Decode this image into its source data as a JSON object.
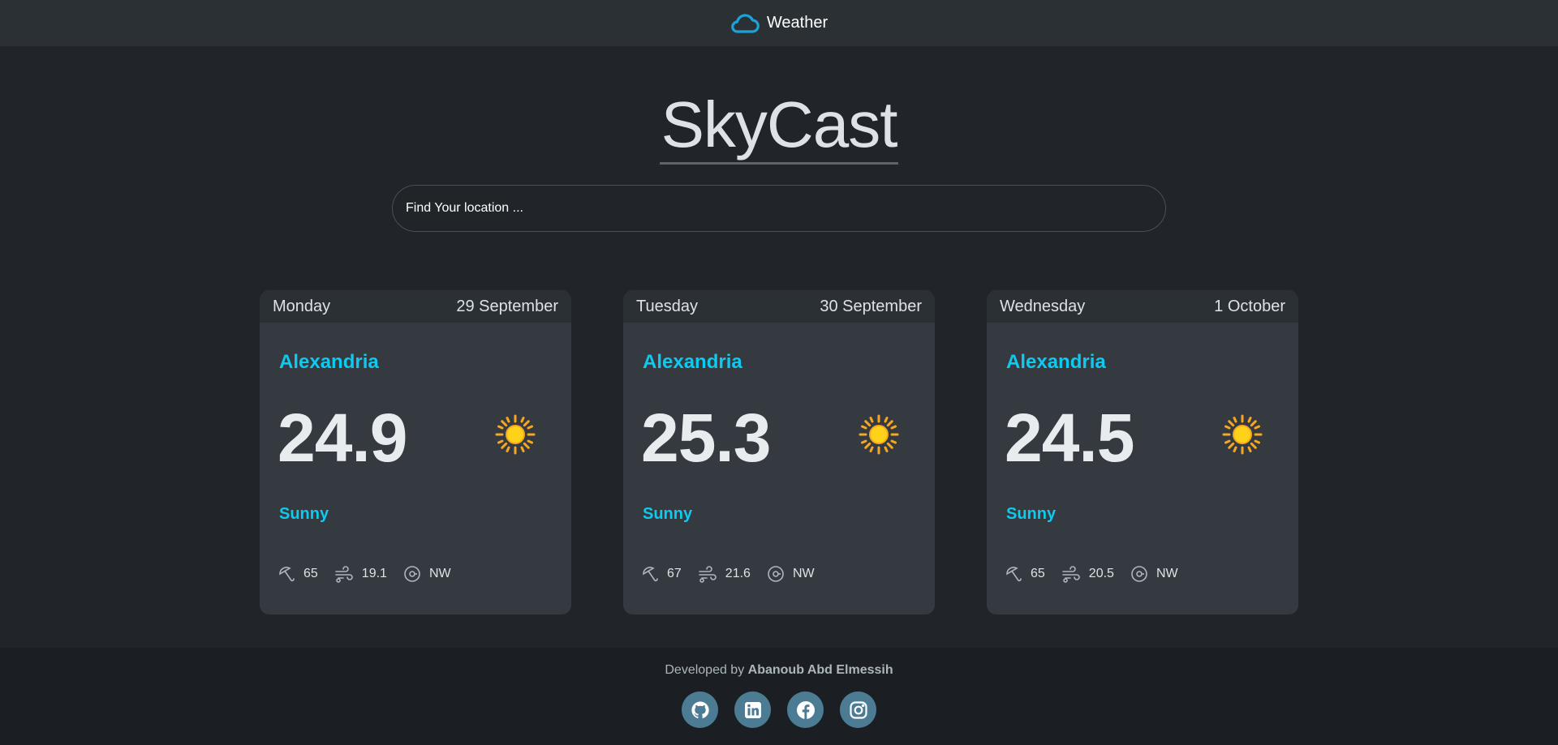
{
  "navbar": {
    "brand": "Weather",
    "brand_icon": "cloud-icon"
  },
  "hero": {
    "title": "SkyCast"
  },
  "search": {
    "placeholder": "Find Your location ..."
  },
  "cards": [
    {
      "day": "Monday",
      "date": "29 September",
      "city": "Alexandria",
      "temp": "24.9",
      "condition": "Sunny",
      "humidity": "65",
      "wind": "19.1",
      "direction": "NW"
    },
    {
      "day": "Tuesday",
      "date": "30 September",
      "city": "Alexandria",
      "temp": "25.3",
      "condition": "Sunny",
      "humidity": "67",
      "wind": "21.6",
      "direction": "NW"
    },
    {
      "day": "Wednesday",
      "date": "1 October",
      "city": "Alexandria",
      "temp": "24.5",
      "condition": "Sunny",
      "humidity": "65",
      "wind": "20.5",
      "direction": "NW"
    }
  ],
  "footer": {
    "prefix": "Developed by",
    "author": "Abanoub Abd Elmessih",
    "socials": [
      "github-icon",
      "linkedin-icon",
      "facebook-icon",
      "instagram-icon"
    ]
  },
  "colors": {
    "accent": "#0dcaf0",
    "background": "#212529",
    "card": "#343a40",
    "social": "#4b7c94"
  }
}
